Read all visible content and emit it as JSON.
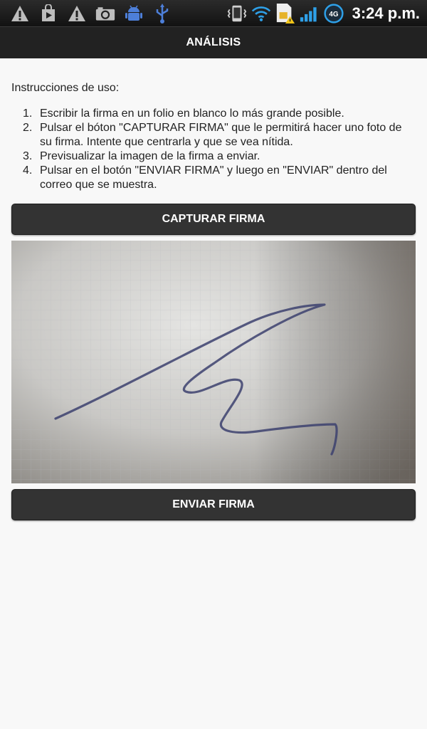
{
  "status_bar": {
    "time": "3:24 p.m.",
    "network_badge": "4G",
    "left_icons": [
      "warning-icon",
      "play-store-icon",
      "warning-icon",
      "camera-icon",
      "android-debug-icon",
      "usb-icon"
    ],
    "right_icons": [
      "vibrate-icon",
      "wifi-icon",
      "sim-warning-icon",
      "signal-icon",
      "data-icon"
    ]
  },
  "header": {
    "title": "ANÁLISIS"
  },
  "instructions": {
    "heading": "Instrucciones de uso:",
    "steps": [
      {
        "num": "1.",
        "text": "Escribir la firma en un folio en blanco lo más grande posible."
      },
      {
        "num": "2.",
        "text": "Pulsar el bóton \"CAPTURAR FIRMA\" que le permitirá hacer uno foto de su firma. Intente que centrarla y que se vea nítida."
      },
      {
        "num": "3.",
        "text": "Previsualizar la imagen de la firma a enviar."
      },
      {
        "num": "4.",
        "text": "Pulsar en el botón \"ENVIAR FIRMA\" y luego en \"ENVIAR\" dentro del correo que se muestra."
      }
    ]
  },
  "buttons": {
    "capture_label": "CAPTURAR FIRMA",
    "send_label": "ENVIAR FIRMA"
  },
  "colors": {
    "status_bar": "#1a1a1a",
    "title_bar": "#222222",
    "button_bg": "#333333",
    "background": "#f8f8f8",
    "ink": "#3a3f6e"
  }
}
